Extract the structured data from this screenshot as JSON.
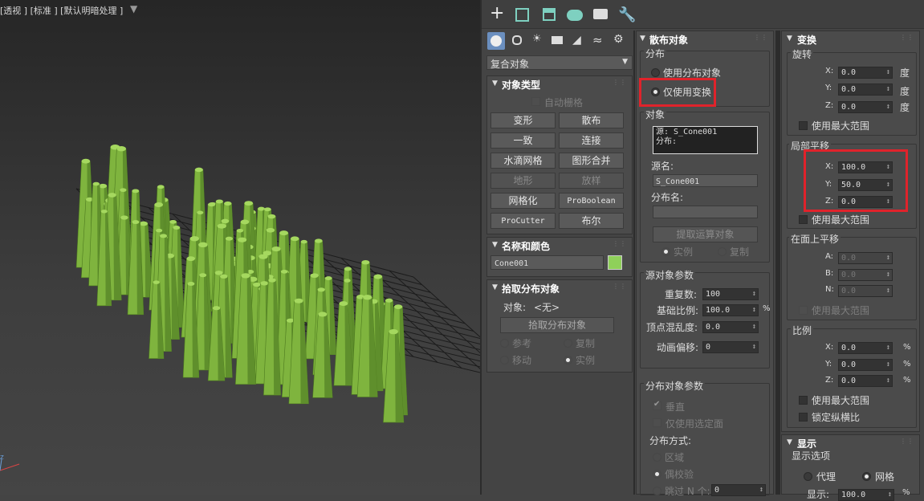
{
  "viewport": {
    "label": "[+] [透视 ] [标准 ] [默认明暗处理 ]",
    "label_visible": "[透视 ] [标准 ] [默认明暗处理 ]",
    "axis_label": "z",
    "filter_icon": "funnel-icon"
  },
  "toptabs": [
    "create-icon",
    "modify-icon",
    "hierarchy-icon",
    "motion-icon",
    "display-icon",
    "utilities-icon"
  ],
  "subtabs": [
    "geometry-icon",
    "shapes-icon",
    "lights-icon",
    "cameras-icon",
    "helpers-icon",
    "spacewarps-icon",
    "systems-icon"
  ],
  "category": "复合对象",
  "object_type": {
    "title": "对象类型",
    "autogrid": "自动栅格",
    "buttons": [
      "变形",
      "散布",
      "一致",
      "连接",
      "水滴网格",
      "图形合并",
      "地形",
      "放样",
      "网格化",
      "ProBoolean",
      "ProCutter",
      "布尔"
    ]
  },
  "name_color": {
    "title": "名称和颜色",
    "name": "Cone001",
    "color": "#8fd05a"
  },
  "pick": {
    "title": "拾取分布对象",
    "object_label": "对象:",
    "object_value": "<无>",
    "pick_btn": "拾取分布对象",
    "opts": [
      "参考",
      "复制",
      "移动",
      "实例"
    ]
  },
  "scatter": {
    "title": "散布对象",
    "dist_group": "分布",
    "use_dist": "使用分布对象",
    "transform_only": "仅使用变换",
    "obj_group": "对象",
    "list_lines": [
      "源: S_Cone001",
      "分布:"
    ],
    "source_name_label": "源名:",
    "source_name": "S_Cone001",
    "dist_name_label": "分布名:",
    "dist_name": "",
    "extract_btn": "提取运算对象",
    "instance": "实例",
    "copy": "复制",
    "src_params": "源对象参数",
    "dup_label": "重复数:",
    "dup": "100",
    "base_scale_label": "基础比例:",
    "base_scale": "100.0",
    "pct": "%",
    "vertex_chaos_label": "顶点混乱度:",
    "vertex_chaos": "0.0",
    "anim_offset_label": "动画偏移:",
    "anim_offset": "0",
    "dist_params": "分布对象参数",
    "perpendicular": "垂直",
    "selected_faces": "仅使用选定面",
    "dist_method": "分布方式:",
    "area": "区域",
    "even": "偶校验",
    "skip": "跳过 N 个:",
    "skip_n": "0"
  },
  "transform": {
    "title": "变换",
    "rotation": "旋转",
    "rot": [
      "0.0",
      "0.0",
      "0.0"
    ],
    "deg": "度",
    "use_max": "使用最大范围",
    "local": "局部平移",
    "loc": [
      "100.0",
      "50.0",
      "0.0"
    ],
    "on_face": "在面上平移",
    "face": [
      "0.0",
      "0.0",
      "0.0"
    ],
    "face_labels": [
      "A:",
      "B:",
      "N:"
    ],
    "scale": "比例",
    "scl": [
      "0.0",
      "0.0",
      "0.0"
    ],
    "lock": "锁定纵横比",
    "xyz": [
      "X:",
      "Y:",
      "Z:"
    ]
  },
  "display": {
    "title": "显示",
    "options": "显示选项",
    "proxy": "代理",
    "mesh": "网格",
    "display_pct_label": "显示:",
    "display_pct": "100.0"
  }
}
